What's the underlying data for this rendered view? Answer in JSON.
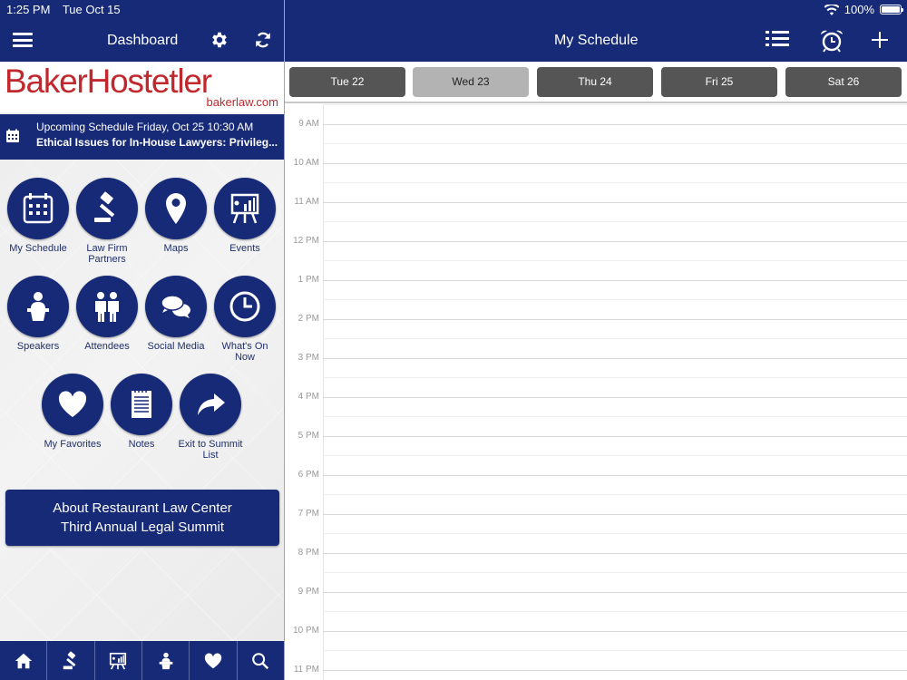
{
  "status": {
    "time": "1:25 PM",
    "date": "Tue Oct 15",
    "battery": "100%"
  },
  "left": {
    "title": "Dashboard",
    "logo": {
      "name": "BakerHostetler",
      "url": "bakerlaw.com"
    },
    "upcoming": {
      "line1": "Upcoming Schedule Friday, Oct 25 10:30 AM",
      "line2": "Ethical Issues for In-House Lawyers: Privileg..."
    },
    "tiles": [
      {
        "label": "My Schedule",
        "icon": "calendar-icon"
      },
      {
        "label": "Law Firm Partners",
        "icon": "gavel-icon"
      },
      {
        "label": "Maps",
        "icon": "map-pin-icon"
      },
      {
        "label": "Events",
        "icon": "presentation-icon"
      },
      {
        "label": "Speakers",
        "icon": "podium-speaker-icon"
      },
      {
        "label": "Attendees",
        "icon": "people-icon"
      },
      {
        "label": "Social Media",
        "icon": "chat-bubbles-icon"
      },
      {
        "label": "What's On Now",
        "icon": "clock-icon"
      },
      {
        "label": "My Favorites",
        "icon": "heart-icon"
      },
      {
        "label": "Notes",
        "icon": "notepad-icon"
      },
      {
        "label": "Exit to Summit List",
        "icon": "share-arrow-icon"
      }
    ],
    "about": {
      "line1": "About Restaurant Law Center",
      "line2": "Third Annual Legal Summit"
    },
    "tabbar": [
      "home-icon",
      "gavel-icon",
      "presentation-icon",
      "podium-speaker-icon",
      "heart-icon",
      "search-icon"
    ]
  },
  "right": {
    "title": "My Schedule",
    "days": [
      {
        "label": "Tue 22",
        "selected": false
      },
      {
        "label": "Wed 23",
        "selected": true
      },
      {
        "label": "Thu 24",
        "selected": false
      },
      {
        "label": "Fri 25",
        "selected": false
      },
      {
        "label": "Sat 26",
        "selected": false
      }
    ],
    "hours": [
      "9 AM",
      "10 AM",
      "11 AM",
      "12 PM",
      "1 PM",
      "2 PM",
      "3 PM",
      "4 PM",
      "5 PM",
      "6 PM",
      "7 PM",
      "8 PM",
      "9 PM",
      "10 PM",
      "11 PM"
    ]
  },
  "colors": {
    "brand_navy": "#162a78",
    "logo_red": "#c0282d",
    "day_button": "#555555",
    "day_selected": "#b3b3b3"
  }
}
